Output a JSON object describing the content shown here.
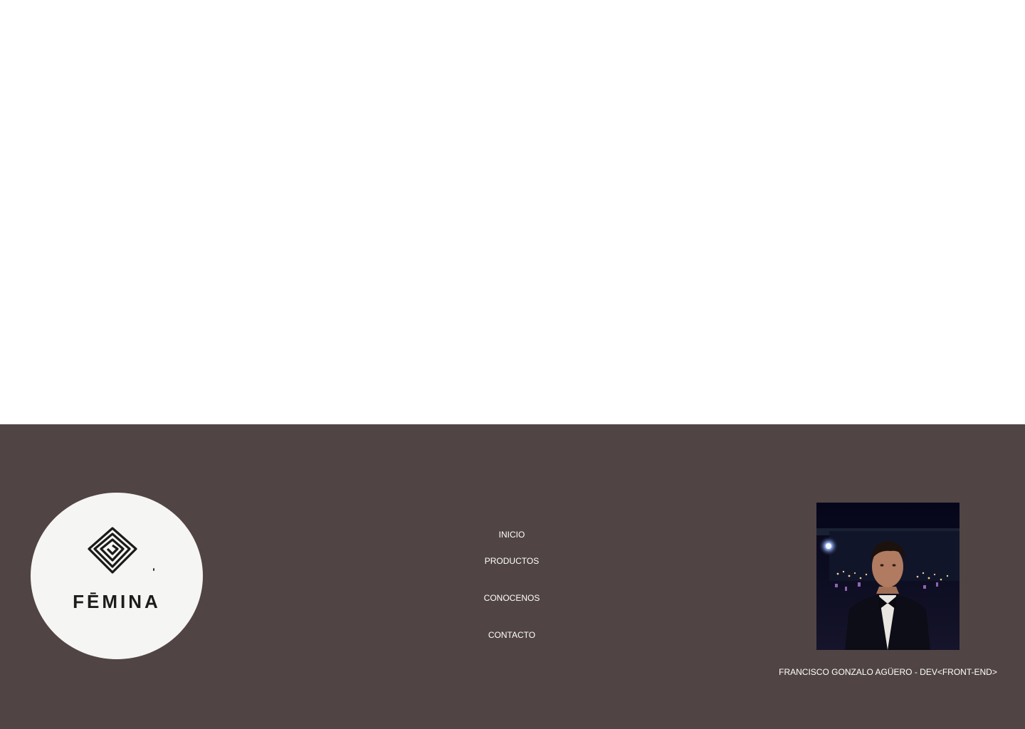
{
  "footer": {
    "brand": {
      "name": "FĒMINA",
      "logo_icon": "concentric-diamond-knot-icon"
    },
    "nav": {
      "items": [
        {
          "label": "INICIO"
        },
        {
          "label": "PRODUCTOS"
        },
        {
          "label": "CONOCENOS"
        },
        {
          "label": "CONTACTO"
        }
      ]
    },
    "developer": {
      "photo": "developer-portrait-photo",
      "credit": "FRANCISCO GONZALO AGÜERO - DEV<FRONT-END>"
    }
  },
  "colors": {
    "footer_bg": "#514444",
    "logo_bg": "#f5f5f3",
    "text": "#ffffff"
  }
}
